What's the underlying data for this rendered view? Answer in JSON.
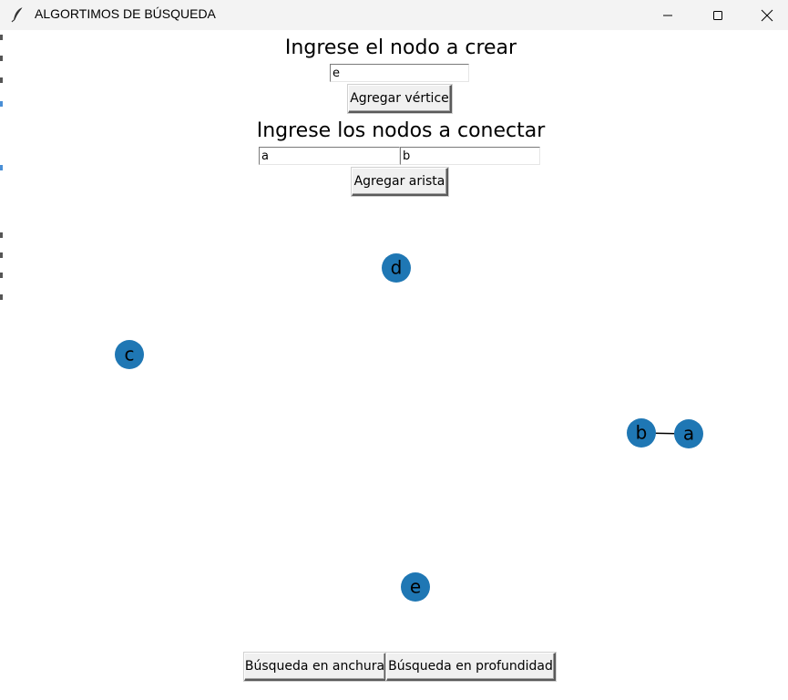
{
  "window": {
    "title": "ALGORTIMOS DE BÚSQUEDA",
    "controls": [
      "minimize-icon",
      "maximize-icon",
      "close-icon"
    ]
  },
  "create_node": {
    "heading": "Ingrese el nodo a crear",
    "input_value": "e",
    "button_label": "Agregar vértice"
  },
  "connect_nodes": {
    "heading": "Ingrese los nodos a conectar",
    "from_value": "a",
    "to_value": "b",
    "button_label": "Agregar arista"
  },
  "graph": {
    "node_color": "#1f77b4",
    "edge_color": "#000000",
    "nodes": [
      {
        "id": "d"
      },
      {
        "id": "c"
      },
      {
        "id": "b"
      },
      {
        "id": "a"
      },
      {
        "id": "e"
      }
    ],
    "edges": [
      {
        "from": "b",
        "to": "a"
      }
    ]
  },
  "search": {
    "bfs_label": "Búsqueda en anchura",
    "dfs_label": "Búsqueda en profundidad"
  }
}
